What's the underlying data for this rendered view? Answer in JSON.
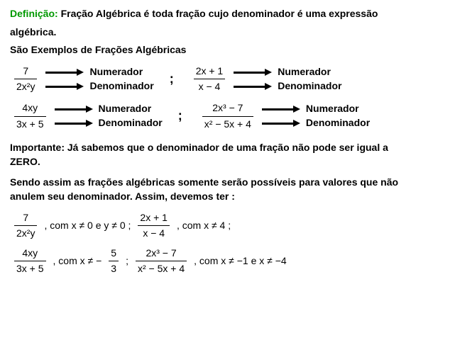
{
  "definition": {
    "label": "Definição:",
    "text_a": "Fração Algébrica é toda fração cujo denominador é uma expressão",
    "text_b": "algébrica."
  },
  "subtitle": "São Exemplos de Frações Algébricas",
  "labels": {
    "numerador": "Numerador",
    "denominador": "Denominador",
    "sep": ";"
  },
  "ex_row1": {
    "left": {
      "num": "7",
      "den": "2x²y"
    },
    "right": {
      "num": "2x + 1",
      "den": "x − 4"
    }
  },
  "ex_row2": {
    "left": {
      "num": "4xy",
      "den": "3x + 5"
    },
    "right": {
      "num": "2x³ − 7",
      "den": "x² − 5x + 4"
    }
  },
  "important": {
    "prefix": "Importante:",
    "line1": "Já sabemos que o denominador de uma fração não pode ser igual a",
    "line2": "ZERO."
  },
  "para2": {
    "line1": "Sendo assim as frações algébricas somente serão possíveis para valores que não",
    "line2": "anulem seu denominador. Assim, devemos ter :"
  },
  "cond1": {
    "frac1": {
      "num": "7",
      "den": "2x²y"
    },
    "text1": ", com x ≠ 0 e y ≠ 0  ;",
    "frac2": {
      "num": "2x + 1",
      "den": "x − 4"
    },
    "text2": ", com x ≠ 4  ;"
  },
  "cond2": {
    "frac1": {
      "num": "4xy",
      "den": "3x + 5"
    },
    "text1a": ", com x ≠ −",
    "inline_frac": {
      "num": "5",
      "den": "3"
    },
    "text1b": "  ;",
    "frac2": {
      "num": "2x³ − 7",
      "den": "x² − 5x + 4"
    },
    "text2": ", com x ≠ −1 e x ≠ −4"
  }
}
